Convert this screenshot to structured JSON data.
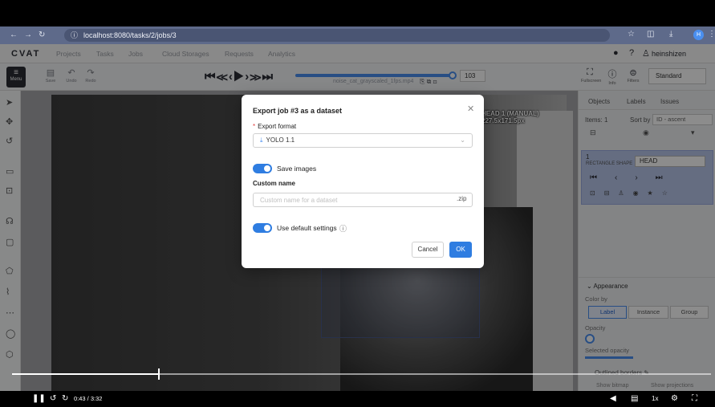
{
  "browser": {
    "url": "localhost:8080/tasks/2/jobs/3"
  },
  "app": {
    "logo": "CVAT",
    "nav": [
      "Projects",
      "Tasks",
      "Jobs",
      "Cloud Storages",
      "Requests",
      "Analytics"
    ],
    "user": "heinshizen"
  },
  "toolbar": {
    "menu_label": "Menu",
    "save_label": "Save",
    "undo_label": "Undo",
    "redo_label": "Redo",
    "player_controls": "⏮≪‹▶›≫⏭",
    "progress": 0.98,
    "file_name": "noise_cat_grayscaled_1fps.mp4",
    "frame_number": "103",
    "fullscreen_label": "Fullscreen",
    "info_label": "Info",
    "filters_label": "Filters",
    "workspace": "Standard"
  },
  "canvas": {
    "bbox_label_line1": "HEAD 1 (MANUAL)",
    "bbox_label_line2": "227.5x171.5px"
  },
  "right_panel": {
    "tabs": [
      "Objects",
      "Labels",
      "Issues"
    ],
    "items": "Items: 1",
    "sort_by": "Sort by",
    "sort_value": "ID - ascent",
    "object_number": "1",
    "object_type": "RECTANGLE SHAPE",
    "object_label": "HEAD",
    "appearance_header": "Appearance",
    "color_by_label": "Color by",
    "color_by_options": [
      "Label",
      "Instance",
      "Group"
    ],
    "opacity_label": "Opacity",
    "selected_opacity_label": "Selected opacity",
    "outlined_borders_label": "Outlined borders",
    "show_bitmap_label": "Show bitmap",
    "show_projections_label": "Show projections"
  },
  "modal": {
    "title": "Export job #3 as a dataset",
    "export_format_label": "Export format",
    "export_format_value": "YOLO 1.1",
    "save_images_label": "Save images",
    "custom_name_label": "Custom name",
    "custom_name_placeholder": "Custom name for a dataset",
    "zip_suffix": ".zip",
    "use_default_settings_label": "Use default settings",
    "cancel_label": "Cancel",
    "ok_label": "OK"
  },
  "video": {
    "progress": 0.21,
    "time": "0:43 / 3:32"
  }
}
